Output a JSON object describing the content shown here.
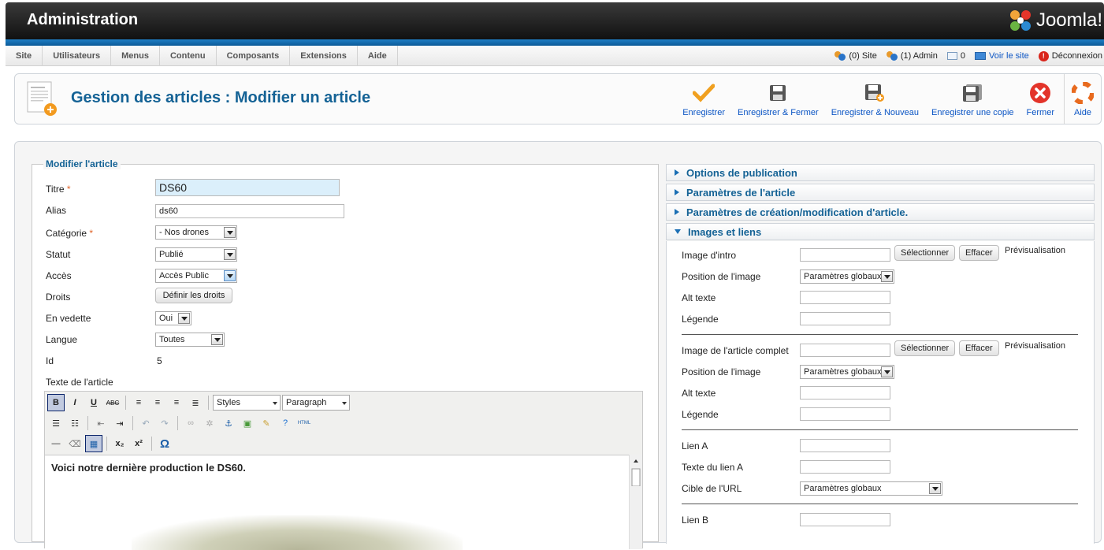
{
  "header": {
    "title": "Administration",
    "logo_text": "Joomla!"
  },
  "menu": [
    "Site",
    "Utilisateurs",
    "Menus",
    "Contenu",
    "Composants",
    "Extensions",
    "Aide"
  ],
  "status": {
    "site": "(0) Site",
    "admin": "(1) Admin",
    "messages": "0",
    "view_site": "Voir le site",
    "logout": "Déconnexion"
  },
  "page": {
    "title": "Gestion des articles : Modifier un article"
  },
  "toolbar": {
    "save": "Enregistrer",
    "save_close": "Enregistrer & Fermer",
    "save_new": "Enregistrer & Nouveau",
    "save_copy": "Enregistrer une copie",
    "close": "Fermer",
    "help": "Aide"
  },
  "form": {
    "legend": "Modifier l'article",
    "titre_label": "Titre",
    "titre_value": "DS60",
    "alias_label": "Alias",
    "alias_value": "ds60",
    "categorie_label": "Catégorie",
    "categorie_value": "- Nos drones",
    "statut_label": "Statut",
    "statut_value": "Publié",
    "acces_label": "Accès",
    "acces_value": "Accès Public",
    "droits_label": "Droits",
    "droits_button": "Définir les droits",
    "vedette_label": "En vedette",
    "vedette_value": "Oui",
    "langue_label": "Langue",
    "langue_value": "Toutes",
    "id_label": "Id",
    "id_value": "5",
    "texte_label": "Texte de l'article",
    "required_mark": "*"
  },
  "editor": {
    "styles": "Styles",
    "format": "Paragraph",
    "content": "Voici notre dernière production le DS60."
  },
  "accordion": {
    "publication": "Options de publication",
    "parametres": "Paramètres de l'article",
    "creation": "Paramètres de création/modification d'article.",
    "images": "Images et liens"
  },
  "images": {
    "intro_label": "Image d'intro",
    "select": "Sélectionner",
    "clear": "Effacer",
    "preview": "Prévisualisation",
    "position_label": "Position de l'image",
    "position_value": "Paramètres globaux",
    "alt_label": "Alt texte",
    "caption_label": "Légende",
    "full_label": "Image de l'article complet",
    "link_a_label": "Lien A",
    "link_a_text_label": "Texte du lien A",
    "url_target_label": "Cible de l'URL",
    "url_target_value": "Paramètres globaux",
    "link_b_label": "Lien B"
  },
  "colors": {
    "accent": "#146295",
    "link": "#0b55c4",
    "header_strip": "#1f7fc6"
  }
}
